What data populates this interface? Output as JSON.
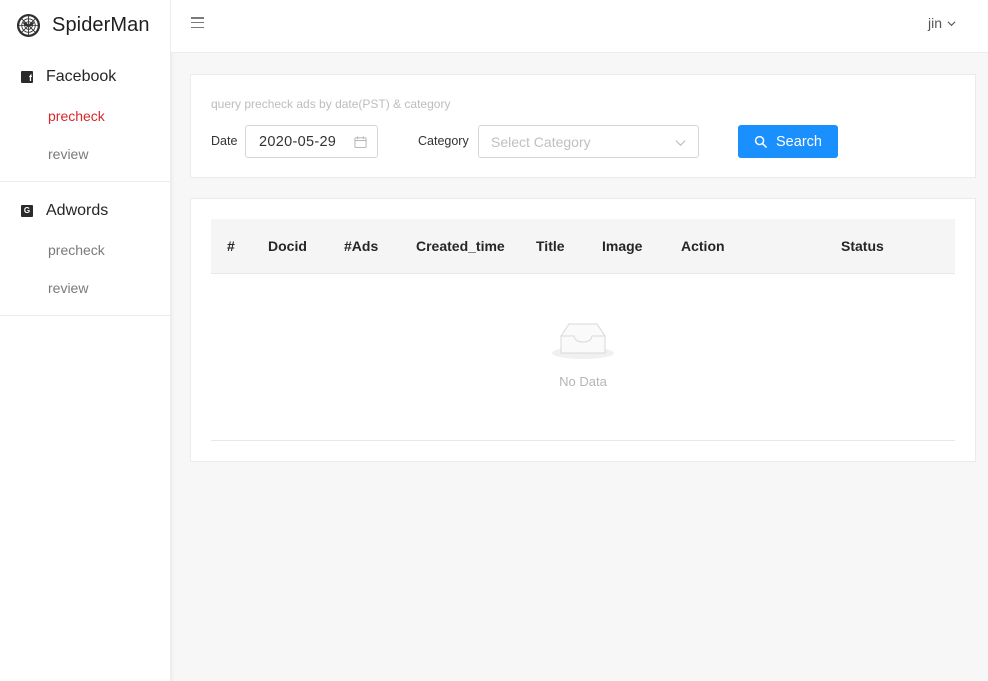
{
  "brand": {
    "name": "SpiderMan",
    "logo_icon": "spider-logo-icon"
  },
  "sidebar": {
    "groups": [
      {
        "label": "Facebook",
        "icon": "facebook-icon",
        "items": [
          {
            "label": "precheck",
            "active": true
          },
          {
            "label": "review",
            "active": false
          }
        ]
      },
      {
        "label": "Adwords",
        "icon": "google-icon",
        "items": [
          {
            "label": "precheck",
            "active": false
          },
          {
            "label": "review",
            "active": false
          }
        ]
      }
    ]
  },
  "header": {
    "menu_icon": "menu-toggle-icon",
    "user": "jin"
  },
  "query": {
    "hint": "query precheck ads by date(PST) & category",
    "date_label": "Date",
    "date_value": "2020-05-29",
    "category_label": "Category",
    "category_placeholder": "Select Category",
    "search_label": "Search"
  },
  "table": {
    "columns": [
      "#",
      "Docid",
      "#Ads",
      "Created_time",
      "Title",
      "Image",
      "Action",
      "Status"
    ],
    "rows": [],
    "empty_text": "No Data"
  },
  "colors": {
    "accent": "#1a90ff",
    "active_nav": "#d9262b",
    "background": "#f7f7f7"
  }
}
